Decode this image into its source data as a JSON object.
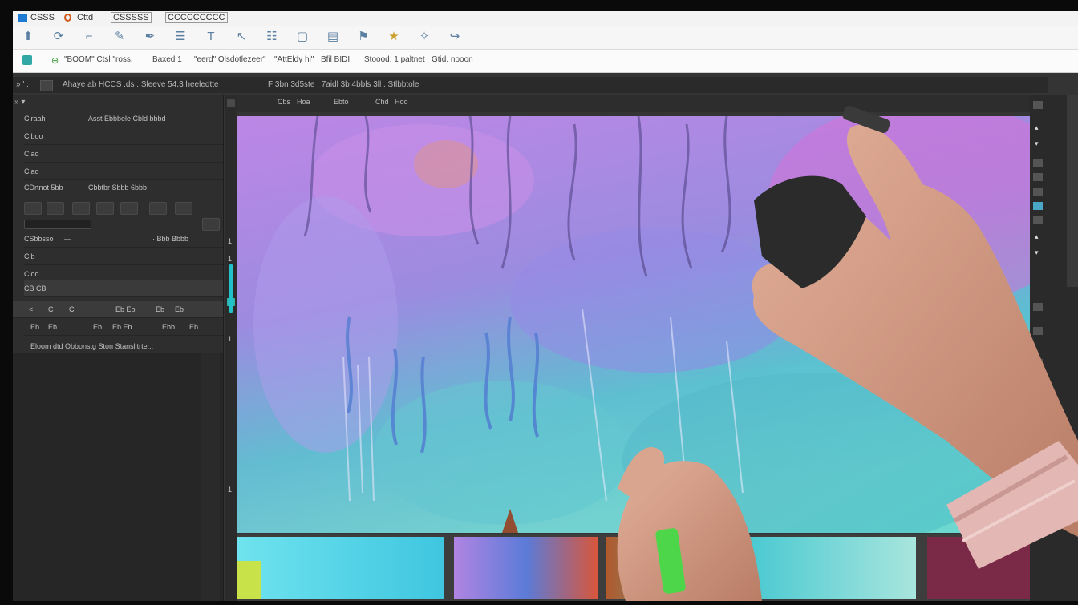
{
  "titlebar": {
    "items": [
      "CSSS",
      "Cttd",
      "CSSSSS",
      "CCCCCCCCC"
    ]
  },
  "toolbar": {
    "tools": [
      "arrow-icon",
      "rotate-icon",
      "crop-icon",
      "brush-icon",
      "pen-icon",
      "layers-icon",
      "text-icon",
      "select-icon",
      "grid-icon",
      "eraser-icon",
      "stack-icon",
      "pin-icon",
      "star-icon",
      "eyedropper-icon",
      "share-icon"
    ]
  },
  "options_bar": {
    "items": [
      "\"BOOM\" Ctsl \"ross.",
      "Baxed 1",
      "\"eerd\" Olsdotlezeer\"",
      "\"AttEldy hi\"",
      "Bfil BIDI",
      "Stoood. 1 paltnet",
      "Gtid. nooon"
    ]
  },
  "menu_strip": {
    "items": [
      "» ' .",
      "Ahaye ab HCCS .ds . Sleeve 54.3 heeledtte",
      "F 3bn 3d5ste . 7aidl 3b 4bbls 3ll . Stlbbtole"
    ]
  },
  "doc_tabs": [
    "Cbs",
    "Hoa",
    "Ebto",
    "Chd",
    "Hoo"
  ],
  "left_panel": {
    "header": "» ▾",
    "rows": [
      {
        "label": "Ciraah",
        "extra": "Asst Ebbbele   Cbld bbbd"
      },
      {
        "label": "Clboo",
        "extra": ""
      },
      {
        "label": "Clao",
        "extra": ""
      },
      {
        "label": "Clao",
        "extra": ""
      },
      {
        "label": "CDrtnot 5bb",
        "extra": "Cbbtbr Sbbb 6bbb"
      }
    ],
    "slider_row": {
      "label": "CSbbsso",
      "value": "—",
      "extra": "· Bbb Bbbb"
    },
    "row_b": "Clb",
    "row_c": "Cloo",
    "row_d": "CB CB",
    "tabs_row": [
      "<",
      "C",
      "C",
      "Eb Eb",
      "Eb",
      "Eb"
    ],
    "icons_row": [
      "Eb",
      "Eb",
      "Eb",
      "Eb Eb",
      "Ebb",
      "Eb"
    ],
    "layer_line": "Eloom dtd Obbonstg Ston Stanslltrte..."
  },
  "toolcol_marks": [
    "1",
    "↑",
    "1",
    "1",
    "1",
    "1"
  ],
  "right_marks": [
    "▴",
    "▾",
    "▴",
    "▾"
  ],
  "colors": {
    "canvas_purple": "#a98be0",
    "canvas_teal": "#4fc7cf",
    "canvas_pink": "#e27ad9",
    "panel_dark": "#2e2e2e",
    "chrome_light": "#f3f3f3"
  }
}
